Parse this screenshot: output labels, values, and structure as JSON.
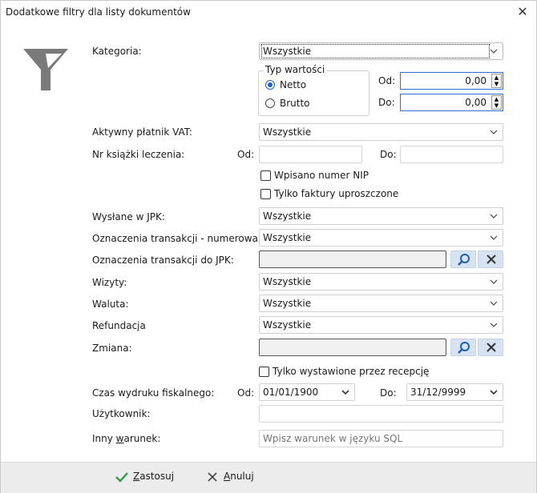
{
  "window": {
    "title": "Dodatkowe filtry dla listy dokumentów",
    "close": "✕"
  },
  "kategoria": {
    "label": "Kategoria:",
    "value": "Wszystkie"
  },
  "typ_wartosci": {
    "legend": "Typ wartości",
    "netto": "Netto",
    "brutto": "Brutto",
    "selected": "Netto",
    "od_label": "Od:",
    "od_value": "0,00",
    "do_label": "Do:",
    "do_value": "0,00"
  },
  "platnik_vat": {
    "label": "Aktywny płatnik VAT:",
    "value": "Wszystkie"
  },
  "ksiazka": {
    "label": "Nr książki leczenia:",
    "od_label": "Od:",
    "do_label": "Do:",
    "od_value": "",
    "do_value": ""
  },
  "wpisano_nip": {
    "label": "Wpisano numer NIP",
    "checked": false
  },
  "tylko_uproszczone": {
    "label": "Tylko faktury uproszczone",
    "checked": false
  },
  "wyslane_jpk": {
    "label": "Wysłane w JPK:",
    "value": "Wszystkie"
  },
  "oznaczenia_num": {
    "label": "Oznaczenia transakcji - numerowanie:",
    "value": "Wszystkie"
  },
  "oznaczenia_jpk": {
    "label": "Oznaczenia transakcji  do JPK:",
    "value": ""
  },
  "wizyty": {
    "label": "Wizyty:",
    "value": "Wszystkie"
  },
  "waluta": {
    "label": "Waluta:",
    "value": "Wszystkie"
  },
  "refundacja": {
    "label": "Refundacja",
    "value": "Wszystkie"
  },
  "zmiana": {
    "label": "Zmiana:",
    "value": ""
  },
  "tylko_recepcja": {
    "label": "Tylko wystawione przez recepcję",
    "checked": false
  },
  "czas_wydruku": {
    "label": "Czas wydruku fiskalnego:",
    "od_label": "Od:",
    "od_value": "01/01/1900",
    "do_label": "Do:",
    "do_value": "31/12/9999"
  },
  "uzytkownik": {
    "label": "Użytkownik:",
    "value": ""
  },
  "inny_warunek": {
    "label_pre": "Inny ",
    "label_u": "w",
    "label_post": "arunek:",
    "placeholder": "Wpisz warunek w języku SQL"
  },
  "footer": {
    "apply_u": "Z",
    "apply_rest": "astosuj",
    "cancel_u": "A",
    "cancel_rest": "nuluj"
  },
  "colors": {
    "accent": "#1a5fd0",
    "search_btn": "#d7e3f2",
    "apply_icon": "#2e9e4e"
  }
}
